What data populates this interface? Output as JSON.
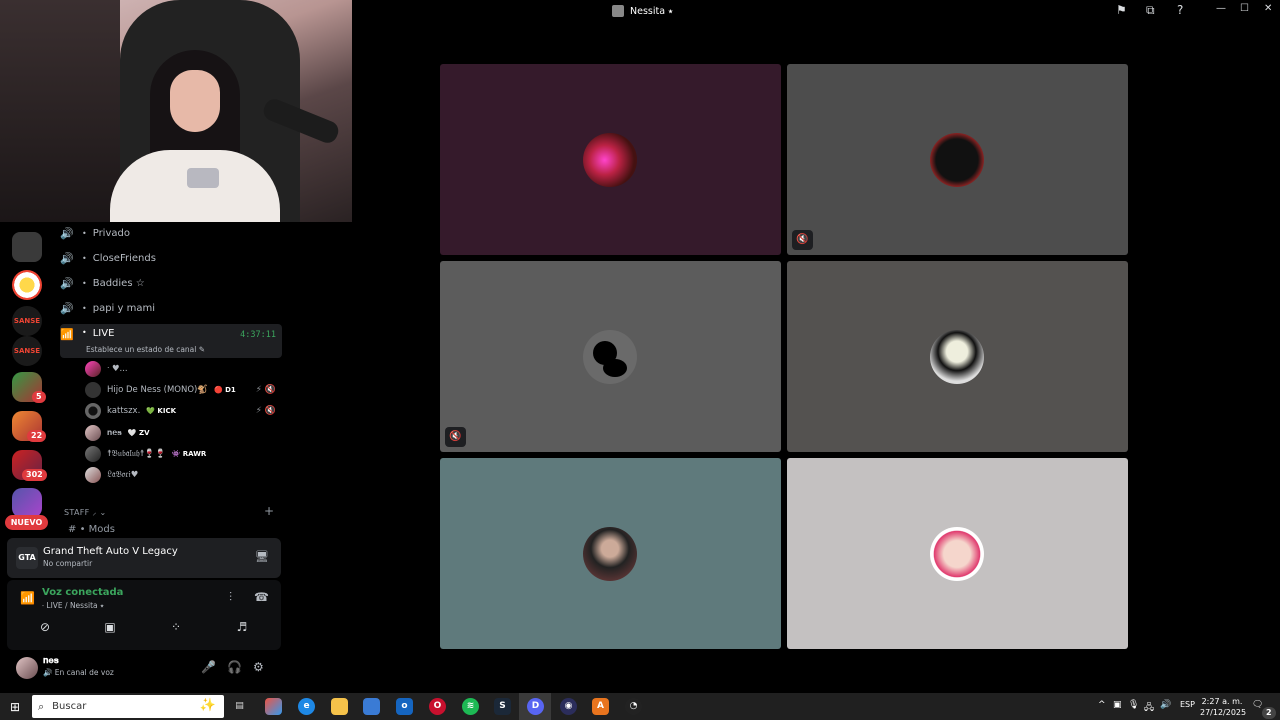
{
  "window": {
    "title": "Nessita ⭑",
    "controls": {
      "minimize": "—",
      "maximize": "☐",
      "close": "✕"
    }
  },
  "channels": {
    "voice_channels": [
      {
        "name": "Privado"
      },
      {
        "name": "CloseFriends"
      },
      {
        "name": "Baddies ☆"
      },
      {
        "name": "papi y mami"
      }
    ],
    "live_channel": {
      "name": "LIVE",
      "timer": "4:37:11",
      "status_prompt": "Establece un estado de canal ✎"
    },
    "members": [
      {
        "name": "ᐧ ♥︎...",
        "tag": "",
        "icons": ""
      },
      {
        "name": "Hijo De Ness (MONO)🐒",
        "tag": "🔴 D1",
        "icons": "⚡ 🔇"
      },
      {
        "name": "kattszx.",
        "tag": "💚 KICK",
        "icons": "⚡ 🔇"
      },
      {
        "name": "𝐧𝐞𝐬",
        "tag": "🤍 ZV",
        "icons": ""
      },
      {
        "name": "☨𝔅𝔲𝔟𝔞𝔩𝔲𝔥☨🍷🍷",
        "tag": "👾 RAWR",
        "icons": ""
      },
      {
        "name": "𝔏𝔞𝔅𝔬𝔯𝔦♥︎",
        "tag": "",
        "icons": ""
      }
    ],
    "category": "STAFF ⸝ ⌄",
    "category_add": "+",
    "partial_channel": "Mods"
  },
  "server_rail": {
    "badges": [
      "5",
      "22",
      "302"
    ],
    "new_label": "NUEVO"
  },
  "activity": {
    "game": "Grand Theft Auto V Legacy",
    "share_state": "No compartir",
    "icon_label": "GTA"
  },
  "voice": {
    "title": "Voz conectada",
    "location": "⸱ LIVE / Nessita ⭑"
  },
  "user": {
    "name": "𝐧𝐞𝐬",
    "status": "🔊 En canal de voz"
  },
  "taskbar": {
    "search_placeholder": "Buscar",
    "lang": "ESP",
    "time": "2:27 a. m.",
    "date": "27/12/2025",
    "notifications": "2"
  },
  "colors": {
    "accent_green": "#3ba55d",
    "badge_red": "#e03a3e",
    "tile_purple": "#351a2b",
    "tile_gray_dark": "#4d4d4d",
    "tile_gray_mid": "#5c5c5c",
    "tile_gray_brown": "#545250",
    "tile_teal": "#5f7a7c",
    "tile_light": "#c4c1c1"
  }
}
